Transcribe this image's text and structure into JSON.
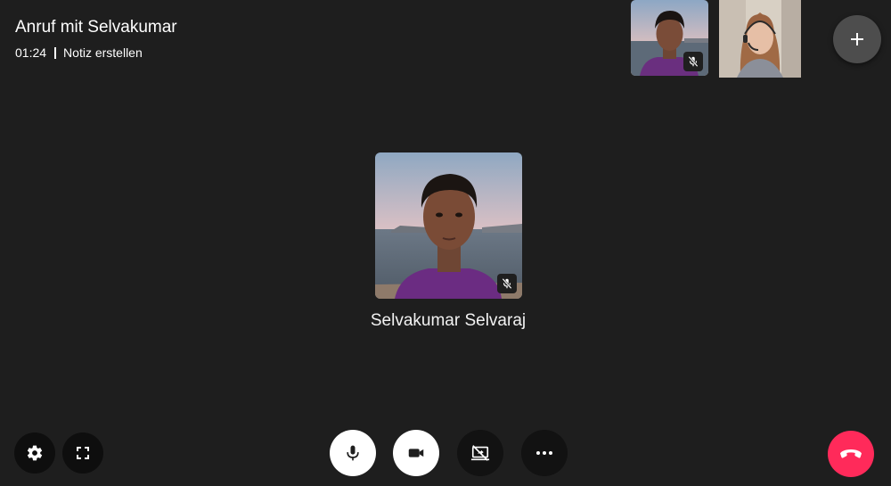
{
  "header": {
    "title": "Anruf mit Selvakumar",
    "duration": "01:24",
    "note_link": "Notiz erstellen"
  },
  "participant": {
    "name": "Selvakumar Selvaraj"
  },
  "icons": {
    "add": "plus-icon",
    "settings": "gear-icon",
    "fullscreen": "fullscreen-icon",
    "mic": "microphone-icon",
    "camera": "video-camera-icon",
    "screen_share": "screen-share-off-icon",
    "more": "more-horizontal-icon",
    "hangup": "phone-hangup-icon",
    "muted": "microphone-off-icon"
  },
  "colors": {
    "background": "#1e1e1e",
    "hangup": "#ff2a5a",
    "add_button": "#4d4d4d"
  }
}
